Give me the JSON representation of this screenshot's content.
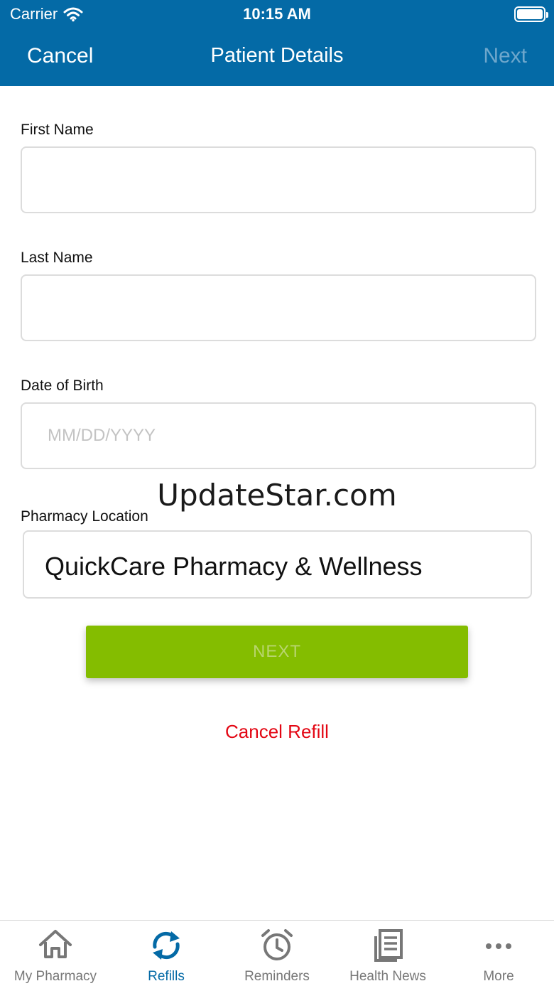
{
  "status_bar": {
    "carrier": "Carrier",
    "time": "10:15 AM"
  },
  "nav": {
    "cancel": "Cancel",
    "title": "Patient Details",
    "next": "Next"
  },
  "form": {
    "first_name": {
      "label": "First Name",
      "value": "",
      "placeholder": ""
    },
    "last_name": {
      "label": "Last Name",
      "value": "",
      "placeholder": ""
    },
    "dob": {
      "label": "Date of Birth",
      "value": "",
      "placeholder": "MM/DD/YYYY"
    },
    "location": {
      "label": "Pharmacy Location",
      "value": "QuickCare Pharmacy & Wellness"
    }
  },
  "watermark": "UpdateStar.com",
  "next_button": "NEXT",
  "cancel_refill": "Cancel Refill",
  "tabs": [
    {
      "label": "My Pharmacy",
      "icon": "home-icon",
      "active": false
    },
    {
      "label": "Refills",
      "icon": "refresh-icon",
      "active": true
    },
    {
      "label": "Reminders",
      "icon": "alarm-clock-icon",
      "active": false
    },
    {
      "label": "Health News",
      "icon": "news-icon",
      "active": false
    },
    {
      "label": "More",
      "icon": "more-dots-icon",
      "active": false
    }
  ],
  "colors": {
    "header": "#046aa6",
    "button": "#84bd00",
    "cancel": "#e30613",
    "active_tab": "#046aa6",
    "inactive_tab": "#777777"
  }
}
